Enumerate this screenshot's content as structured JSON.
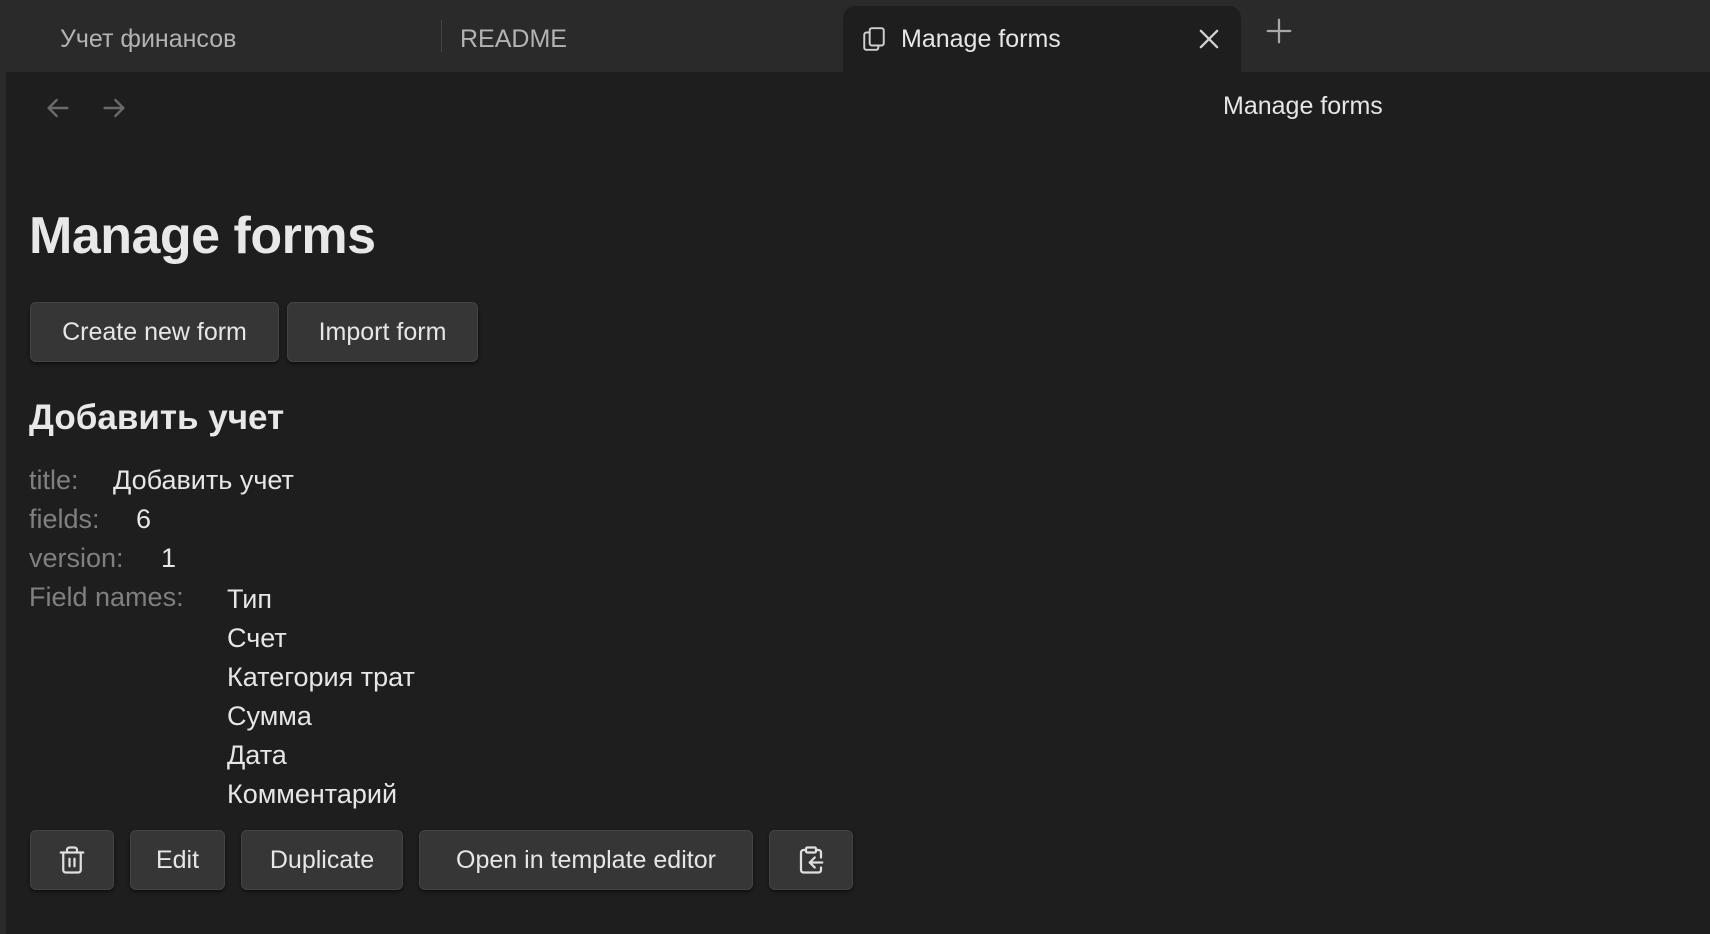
{
  "tabs": [
    {
      "label": "Учет финансов"
    },
    {
      "label": "README"
    },
    {
      "label": "Manage forms",
      "icon": "copy-icon",
      "active": true
    }
  ],
  "header": {
    "view_title": "Manage forms"
  },
  "main": {
    "page_title": "Manage forms",
    "create_button": "Create new form",
    "import_button": "Import form",
    "form": {
      "heading": "Добавить учет",
      "title_key": "title:",
      "title_value": "Добавить учет",
      "fields_key": "fields:",
      "fields_value": "6",
      "version_key": "version:",
      "version_value": "1",
      "field_names_key": "Field names:",
      "field_names": [
        "Тип",
        "Счет",
        "Категория трат",
        "Сумма",
        "Дата",
        "Комментарий"
      ],
      "actions": {
        "delete_icon": "trash-icon",
        "edit": "Edit",
        "duplicate": "Duplicate",
        "template_editor": "Open in template editor",
        "clipboard_icon": "clipboard-import-icon"
      }
    }
  },
  "colors": {
    "background": "#1e1e1e",
    "tabbar": "#2a2a2a",
    "button": "#363636",
    "muted_text": "#808080",
    "text": "#e6e6e6"
  }
}
